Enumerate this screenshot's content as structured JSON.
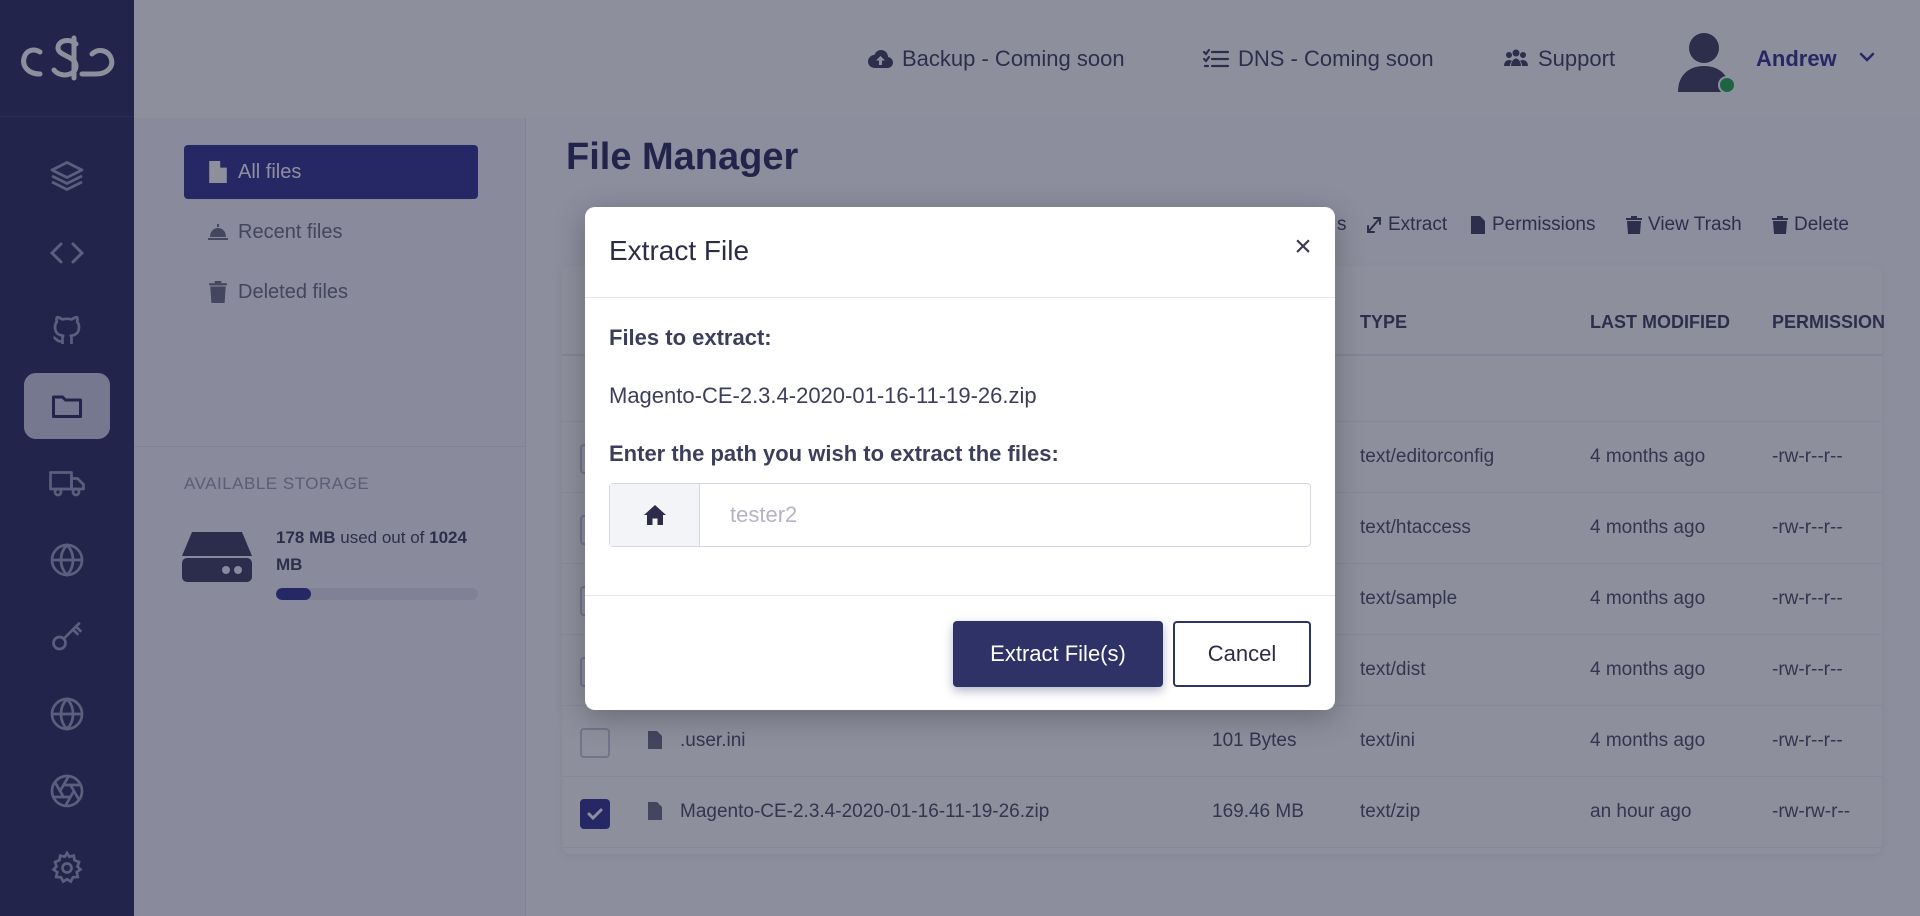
{
  "app": {
    "logo_icon": "cloud-logo-icon"
  },
  "rail": {
    "items": [
      {
        "name": "layers-icon",
        "active": false
      },
      {
        "name": "code-icon",
        "active": false
      },
      {
        "name": "github-icon",
        "active": false
      },
      {
        "name": "folder-icon",
        "active": true
      },
      {
        "name": "truck-icon",
        "active": false
      },
      {
        "name": "globe-icon",
        "active": false
      },
      {
        "name": "key-icon",
        "active": false
      },
      {
        "name": "globe-icon",
        "active": false
      },
      {
        "name": "aperture-icon",
        "active": false
      },
      {
        "name": "gear-icon",
        "active": false
      }
    ]
  },
  "header": {
    "backup_label": "Backup - Coming soon",
    "dns_label": "DNS - Coming soon",
    "support_label": "Support",
    "username": "Andrew",
    "online_status_color": "#1fa84a"
  },
  "filenav": {
    "all_files": "All files",
    "recent_files": "Recent files",
    "deleted_files": "Deleted files",
    "storage_title": "AVAILABLE STORAGE",
    "storage_used": "178 MB",
    "storage_mid": " used out of ",
    "storage_total": "1024 MB",
    "storage_used_fraction": 0.174
  },
  "main": {
    "page_title": "File Manager",
    "toolbar": {
      "partial_label": "s",
      "extract": "Extract",
      "permissions": "Permissions",
      "view_trash": "View Trash",
      "delete": "Delete"
    },
    "columns": {
      "type": "TYPE",
      "last_modified": "LAST MODIFIED",
      "permission": "PERMISSION"
    },
    "rows": [
      {
        "name": "",
        "size": "",
        "type": "text/editorconfig",
        "modified": "4 months ago",
        "perm": "-rw-r--r--",
        "checked": false
      },
      {
        "name": "",
        "size": "",
        "type": "text/htaccess",
        "modified": "4 months ago",
        "perm": "-rw-r--r--",
        "checked": false
      },
      {
        "name": "",
        "size": "",
        "type": "text/sample",
        "modified": "4 months ago",
        "perm": "-rw-r--r--",
        "checked": false
      },
      {
        "name": "",
        "size": "",
        "type": "text/dist",
        "modified": "4 months ago",
        "perm": "-rw-r--r--",
        "checked": false
      },
      {
        "name": ".user.ini",
        "size": "101 Bytes",
        "type": "text/ini",
        "modified": "4 months ago",
        "perm": "-rw-r--r--",
        "checked": false
      },
      {
        "name": "Magento-CE-2.3.4-2020-01-16-11-19-26.zip",
        "size": "169.46 MB",
        "type": "text/zip",
        "modified": "an hour ago",
        "perm": "-rw-rw-r--",
        "checked": true
      }
    ]
  },
  "modal": {
    "title": "Extract File",
    "close_symbol": "×",
    "files_label": "Files to extract:",
    "filename": "Magento-CE-2.3.4-2020-01-16-11-19-26.zip",
    "path_label": "Enter the path you wish to extract the files:",
    "path_placeholder": "tester2",
    "path_value": "",
    "extract_button": "Extract File(s)",
    "cancel_button": "Cancel"
  }
}
